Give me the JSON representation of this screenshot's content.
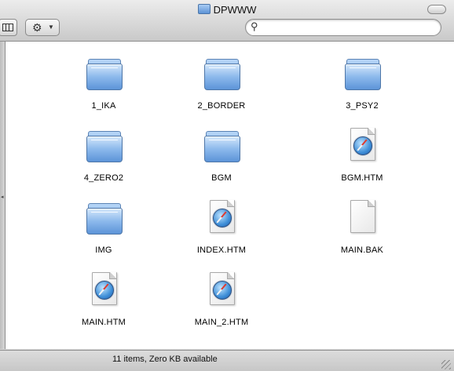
{
  "window": {
    "title": "DPWWW"
  },
  "toolbar": {
    "view_icon": "list-view-icon",
    "action_icon": "gear-icon",
    "search_value": "",
    "search_placeholder": ""
  },
  "items": [
    {
      "name": "1_IKA",
      "kind": "folder"
    },
    {
      "name": "2_BORDER",
      "kind": "folder"
    },
    {
      "name": "3_PSY2",
      "kind": "folder"
    },
    {
      "name": "4_ZERO2",
      "kind": "folder"
    },
    {
      "name": "BGM",
      "kind": "folder"
    },
    {
      "name": "BGM.HTM",
      "kind": "html-document"
    },
    {
      "name": "IMG",
      "kind": "folder"
    },
    {
      "name": "INDEX.HTM",
      "kind": "html-document"
    },
    {
      "name": "MAIN.BAK",
      "kind": "blank-document"
    },
    {
      "name": "MAIN.HTM",
      "kind": "html-document"
    },
    {
      "name": "MAIN_2.HTM",
      "kind": "html-document"
    }
  ],
  "status": {
    "text": "11 items, Zero KB available"
  },
  "colors": {
    "folder_blue": "#5f97dc",
    "window_gray": "#d8d8d8"
  }
}
